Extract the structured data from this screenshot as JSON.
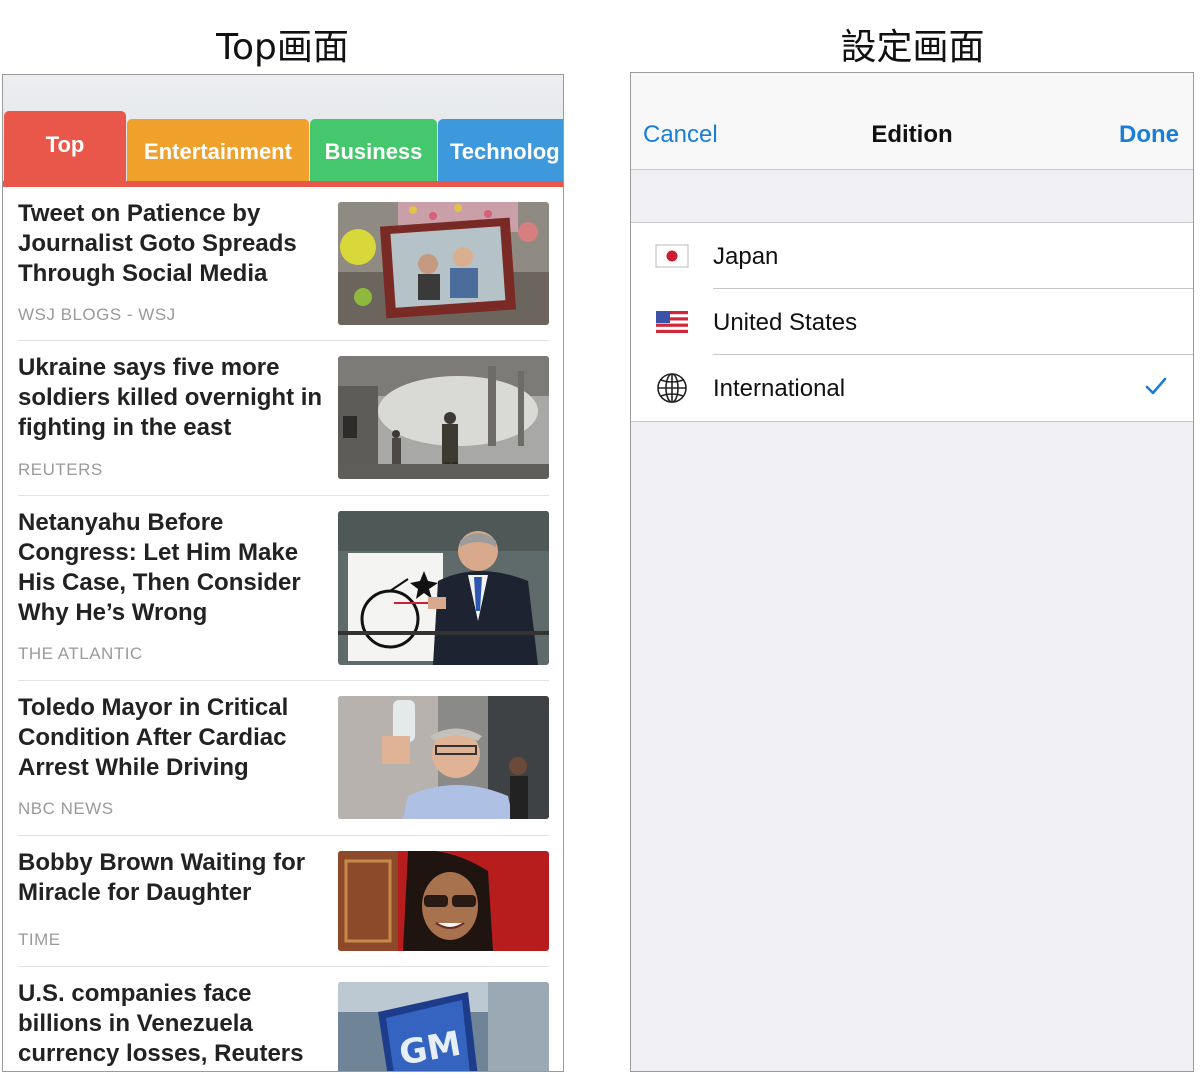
{
  "captions": {
    "left": "Top画面",
    "right": "設定画面"
  },
  "news_app": {
    "tabs": [
      {
        "label": "Top",
        "color": "#e9574b"
      },
      {
        "label": "Entertainment",
        "color": "#efa12b"
      },
      {
        "label": "Business",
        "color": "#45c86d"
      },
      {
        "label": "Technolog",
        "color": "#3d99dc"
      }
    ],
    "articles": [
      {
        "headline": "Tweet on Patience by Journalist Goto Spreads Through Social Media",
        "source": "WSJ BLOGS - WSJ"
      },
      {
        "headline": "Ukraine says five more soldiers killed overnight in fighting in the east",
        "source": "REUTERS"
      },
      {
        "headline": "Netanyahu Before Congress: Let Him Make His Case, Then Consider Why He’s Wrong",
        "source": "THE ATLANTIC"
      },
      {
        "headline": "Toledo Mayor in Critical Condition After Cardiac Arrest While Driving",
        "source": "NBC NEWS"
      },
      {
        "headline": "Bobby Brown Waiting for Miracle for Daughter",
        "source": "TIME"
      },
      {
        "headline": "U.S. companies face billions in Venezuela currency losses, Reuters",
        "source": ""
      }
    ]
  },
  "settings": {
    "nav": {
      "cancel": "Cancel",
      "title": "Edition",
      "done": "Done"
    },
    "editions": [
      {
        "label": "Japan",
        "icon": "japan-flag-icon",
        "selected": false
      },
      {
        "label": "United States",
        "icon": "us-flag-icon",
        "selected": false
      },
      {
        "label": "International",
        "icon": "globe-icon",
        "selected": true
      }
    ],
    "accent_color": "#1a7ed6"
  }
}
